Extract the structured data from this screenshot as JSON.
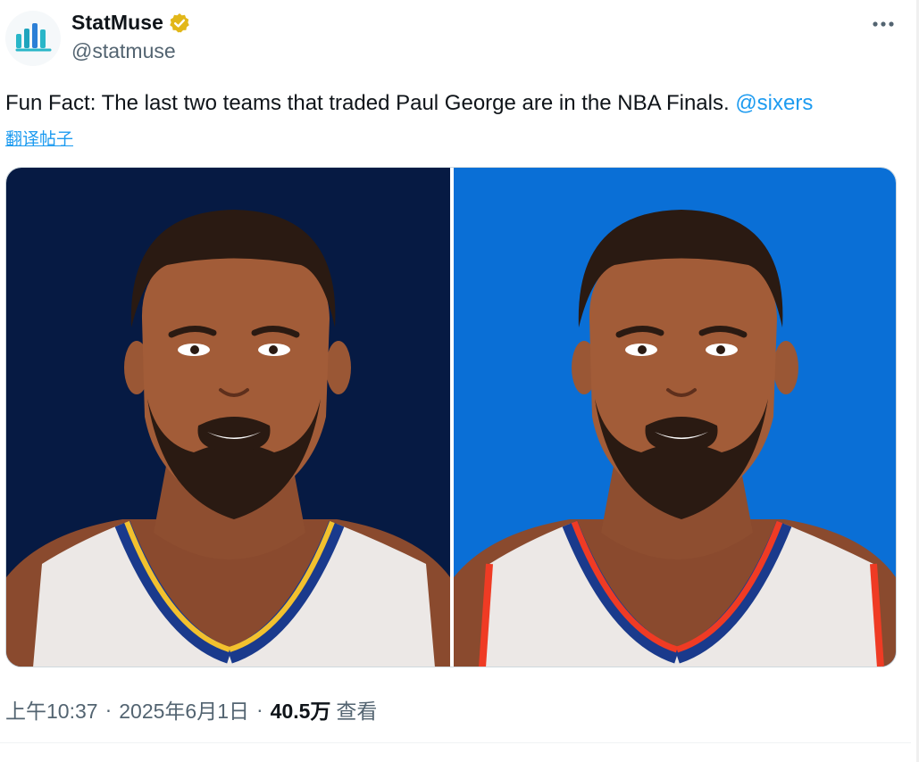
{
  "account": {
    "display_name": "StatMuse",
    "handle": "@statmuse",
    "verified_icon": "verified-badge-icon",
    "avatar_icon": "statmuse-logo"
  },
  "tweet": {
    "text": "Fun Fact: The last two teams that traded Paul George are in the NBA Finals. ",
    "mention": "@sixers",
    "translate_label": "翻译帖子"
  },
  "media": {
    "images": [
      {
        "name": "paul-george-pacers-illustration",
        "background": "#061a43",
        "jersey_trim": [
          "#1a3a8c",
          "#f2c12e"
        ]
      },
      {
        "name": "paul-george-thunder-illustration",
        "background": "#0a6fd6",
        "jersey_trim": [
          "#1a3a8c",
          "#ef3b24"
        ]
      }
    ]
  },
  "meta": {
    "time": "上午10:37",
    "separator": "·",
    "date": "2025年6月1日",
    "views_count": "40.5万",
    "views_label": "查看"
  },
  "colors": {
    "accent": "#1d9bf0",
    "text_primary": "#0f1419",
    "text_secondary": "#536471",
    "verified": "#e2b719"
  }
}
